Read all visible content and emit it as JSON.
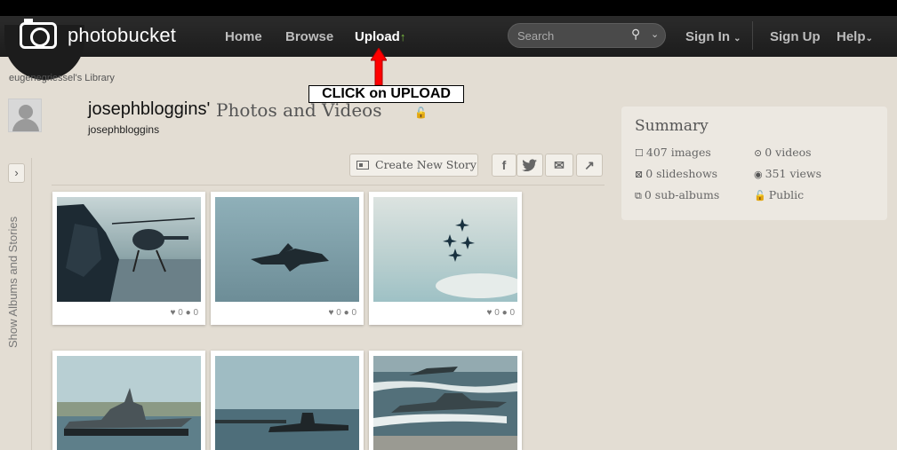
{
  "header": {
    "logo_text": "photobucket",
    "nav": {
      "home": "Home",
      "browse": "Browse",
      "upload": "Upload",
      "upload_arrow": "↑",
      "sign_in": "Sign In",
      "sign_up": "Sign Up",
      "help": "Help"
    },
    "search": {
      "placeholder": "Search",
      "value": ""
    },
    "chevron_glyph": "⌄"
  },
  "breadcrumb": {
    "library": "eugenegriessel's Library"
  },
  "annotation": {
    "text": "CLICK on UPLOAD",
    "color": "#ff0000"
  },
  "profile": {
    "owner": "josephbloggins'",
    "title_rest": "Photos and Videos",
    "username": "josephbloggins"
  },
  "sidebar": {
    "label": "Show Albums and Stories",
    "toggle": "›"
  },
  "toolbar": {
    "create_story": "Create New Story",
    "share": {
      "facebook": "f",
      "twitter": "t",
      "email": "✉",
      "share": "↗"
    }
  },
  "thumbnails": [
    {
      "likes": "0",
      "comments": "0"
    },
    {
      "likes": "0",
      "comments": "0"
    },
    {
      "likes": "0",
      "comments": "0"
    },
    {
      "likes": "",
      "comments": ""
    },
    {
      "likes": "",
      "comments": ""
    },
    {
      "likes": "",
      "comments": ""
    }
  ],
  "summary": {
    "title": "Summary",
    "images": "407 images",
    "videos": "0 videos",
    "slideshows": "0 slideshows",
    "views": "351 views",
    "subalbums": "0 sub-albums",
    "privacy": "Public"
  },
  "colors": {
    "nav_bg": "#1c1c1c",
    "page_bg": "#e3ddd3",
    "accent_green": "#7bbf3f"
  }
}
